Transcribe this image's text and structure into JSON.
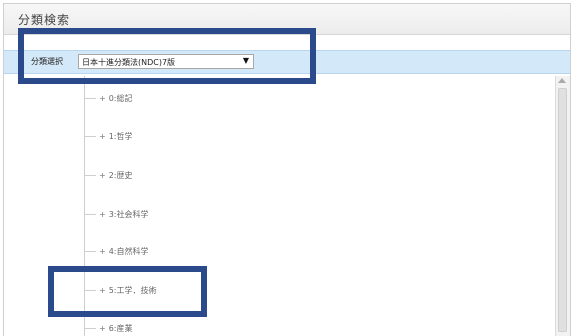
{
  "window": {
    "title": "分類検索"
  },
  "classification": {
    "label": "分類選択",
    "selected": "日本十進分類法(NDC)7版",
    "arrow_icon": "triangle-down"
  },
  "tree": {
    "items": [
      {
        "plus": "+",
        "label": "0:総記"
      },
      {
        "plus": "+",
        "label": "1:哲学"
      },
      {
        "plus": "+",
        "label": "2:歴史"
      },
      {
        "plus": "+",
        "label": "3:社会科学"
      },
      {
        "plus": "+",
        "label": "4:自然科学"
      },
      {
        "plus": "+",
        "label": "5:工学．技術"
      },
      {
        "plus": "+",
        "label": "6:産業"
      }
    ]
  },
  "annotations": {
    "highlight_color": "#2b4a8c"
  }
}
